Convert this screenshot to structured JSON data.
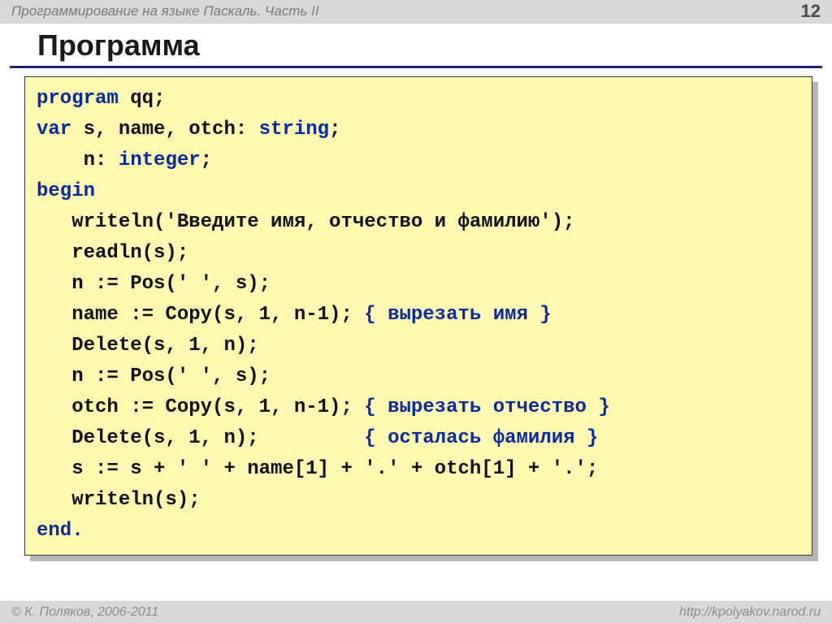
{
  "header": {
    "subtitle": "Программирование на языке Паскаль. Часть II",
    "page_number": "12"
  },
  "title": "Программа",
  "code": {
    "lines": [
      {
        "seg": [
          {
            "t": "program",
            "c": "kw"
          },
          {
            "t": " qq;"
          }
        ]
      },
      {
        "seg": [
          {
            "t": "var",
            "c": "kw"
          },
          {
            "t": " s, name, otch: "
          },
          {
            "t": "string",
            "c": "kw"
          },
          {
            "t": ";"
          }
        ]
      },
      {
        "seg": [
          {
            "t": "    n: "
          },
          {
            "t": "integer",
            "c": "kw"
          },
          {
            "t": ";"
          }
        ]
      },
      {
        "seg": [
          {
            "t": "begin",
            "c": "kw"
          }
        ]
      },
      {
        "seg": [
          {
            "t": "   writeln('Введите имя, отчество и фамилию');"
          }
        ]
      },
      {
        "seg": [
          {
            "t": "   readln(s);"
          }
        ]
      },
      {
        "seg": [
          {
            "t": "   n := Pos(' ', s);"
          }
        ]
      },
      {
        "seg": [
          {
            "t": "   name := Copy(s, 1, n-1); "
          },
          {
            "t": "{ вырезать имя }",
            "c": "cm"
          }
        ]
      },
      {
        "seg": [
          {
            "t": "   Delete(s, 1, n);"
          }
        ]
      },
      {
        "seg": [
          {
            "t": "   n := Pos(' ', s);"
          }
        ]
      },
      {
        "seg": [
          {
            "t": "   otch := Copy(s, 1, n-1); "
          },
          {
            "t": "{ вырезать отчество }",
            "c": "cm"
          }
        ]
      },
      {
        "seg": [
          {
            "t": "   Delete(s, 1, n);         "
          },
          {
            "t": "{ осталась фамилия }",
            "c": "cm"
          }
        ]
      },
      {
        "seg": [
          {
            "t": "   s := s + ' ' + name[1] + '.' + otch[1] + '.';"
          }
        ]
      },
      {
        "seg": [
          {
            "t": "   writeln(s);"
          }
        ]
      },
      {
        "seg": [
          {
            "t": "end.",
            "c": "kw"
          }
        ]
      }
    ]
  },
  "footer": {
    "copyright": "© К. Поляков, 2006-2011",
    "url": "http://kpolyakov.narod.ru"
  }
}
